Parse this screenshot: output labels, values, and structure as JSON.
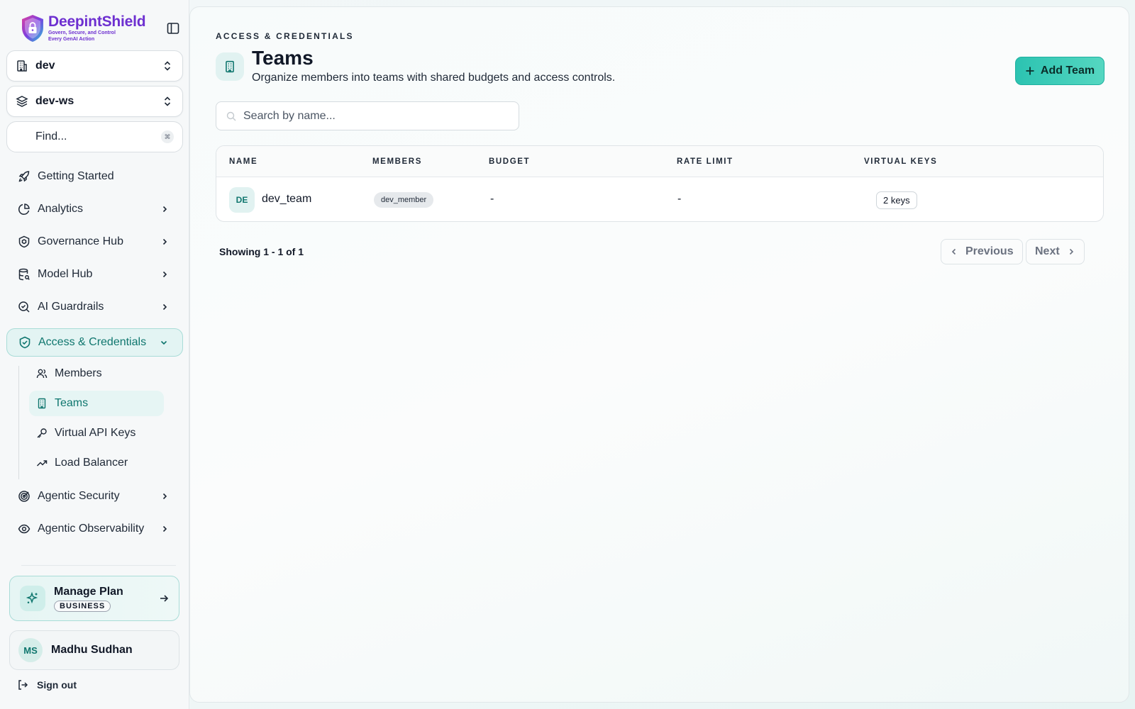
{
  "brand": {
    "name": "DeepintShield",
    "tagline_line1": "Govern, Secure, and Control",
    "tagline_line2": "Every GenAI Action",
    "colors": {
      "brand": "#6d2fd0",
      "accent": "#0f766e",
      "button": "#2cc3b1"
    }
  },
  "selectors": {
    "org": {
      "label": "dev",
      "icon": "building-icon"
    },
    "workspace": {
      "label": "dev-ws",
      "icon": "layers-icon"
    }
  },
  "find": {
    "label": "Find...",
    "shortcut": "⌘"
  },
  "nav": [
    {
      "label": "Getting Started",
      "icon": "rocket-icon"
    },
    {
      "label": "Analytics",
      "icon": "pie-chart-icon"
    },
    {
      "label": "Governance Hub",
      "icon": "shield-hex-icon"
    },
    {
      "label": "Model Hub",
      "icon": "database-icon"
    },
    {
      "label": "AI Guardrails",
      "icon": "search-check-icon"
    },
    {
      "label": "Access & Credentials",
      "icon": "shield-check-icon"
    },
    {
      "label": "Agentic Security",
      "icon": "target-icon"
    },
    {
      "label": "Agentic Observability",
      "icon": "eye-icon"
    }
  ],
  "subnav": [
    {
      "label": "Members",
      "icon": "users-icon"
    },
    {
      "label": "Teams",
      "icon": "building-icon"
    },
    {
      "label": "Virtual API Keys",
      "icon": "key-icon"
    },
    {
      "label": "Load Balancer",
      "icon": "trending-up-icon"
    }
  ],
  "plan": {
    "title": "Manage Plan",
    "badge": "BUSINESS"
  },
  "user": {
    "initials": "MS",
    "name": "Madhu Sudhan"
  },
  "signout": {
    "label": "Sign out"
  },
  "page": {
    "eyebrow": "ACCESS & CREDENTIALS",
    "title": "Teams",
    "description": "Organize members into teams with shared budgets and access controls.",
    "add_button": "Add Team"
  },
  "search": {
    "placeholder": "Search by name...",
    "value": ""
  },
  "table": {
    "columns": [
      "NAME",
      "MEMBERS",
      "BUDGET",
      "RATE LIMIT",
      "VIRTUAL KEYS"
    ],
    "rows": [
      {
        "initials": "DE",
        "name": "dev_team",
        "member": "dev_member",
        "budget": "-",
        "rate_limit": "-",
        "virtual_keys": "2 keys"
      }
    ]
  },
  "pagination": {
    "showing": "Showing 1 - 1 of 1",
    "previous": "Previous",
    "next": "Next"
  }
}
